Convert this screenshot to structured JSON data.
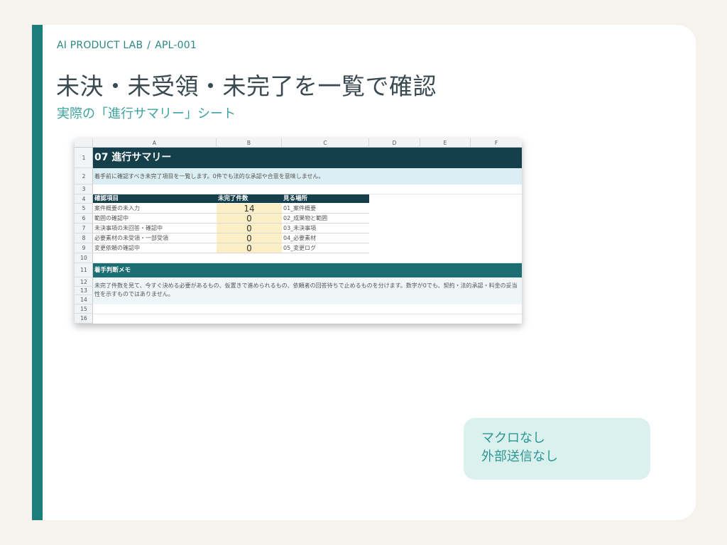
{
  "header": {
    "org": "AI PRODUCT LAB",
    "separator": "/",
    "code": "APL-001",
    "title": "未決・未受領・未完了を一覧で確認",
    "subtitle": "実際の「進行サマリー」シート"
  },
  "sheet": {
    "columns": [
      "A",
      "B",
      "C",
      "D",
      "E",
      "F"
    ],
    "rows": [
      "1",
      "2",
      "3",
      "4",
      "5",
      "6",
      "7",
      "8",
      "9",
      "10",
      "11",
      "12",
      "13",
      "14",
      "15",
      "16"
    ],
    "title": "07 進行サマリー",
    "description": "着手前に確認すべき未完了項目を一覧します。0件でも法的な承認や合意を意味しません。",
    "table_headers": [
      "確認項目",
      "未完了件数",
      "見る場所"
    ],
    "table_rows": [
      {
        "item": "案件概要の未入力",
        "count": "14",
        "location": "01_案件概要"
      },
      {
        "item": "範囲の確認中",
        "count": "0",
        "location": "02_成果物と範囲"
      },
      {
        "item": "未決事項の未回答・確認中",
        "count": "0",
        "location": "03_未決事項"
      },
      {
        "item": "必要素材の未受領・一部受領",
        "count": "0",
        "location": "04_必要素材"
      },
      {
        "item": "変更依頼の確認中",
        "count": "0",
        "location": "05_変更ログ"
      }
    ],
    "memo_heading": "着手判断メモ",
    "memo_text": "未完了件数を見て、今すぐ決める必要があるもの、仮置きで進められるもの、依頼者の回答待ちで止めるものを分けます。数字が0でも、契約・法的承認・料金の妥当性を示すものではありません。"
  },
  "badge": {
    "line1": "マクロなし",
    "line2": "外部送信なし"
  },
  "colors": {
    "accent": "#1c7e7c",
    "sheet_header": "#153f4b",
    "section_header": "#1c6e72",
    "highlight": "#fcefc5"
  }
}
